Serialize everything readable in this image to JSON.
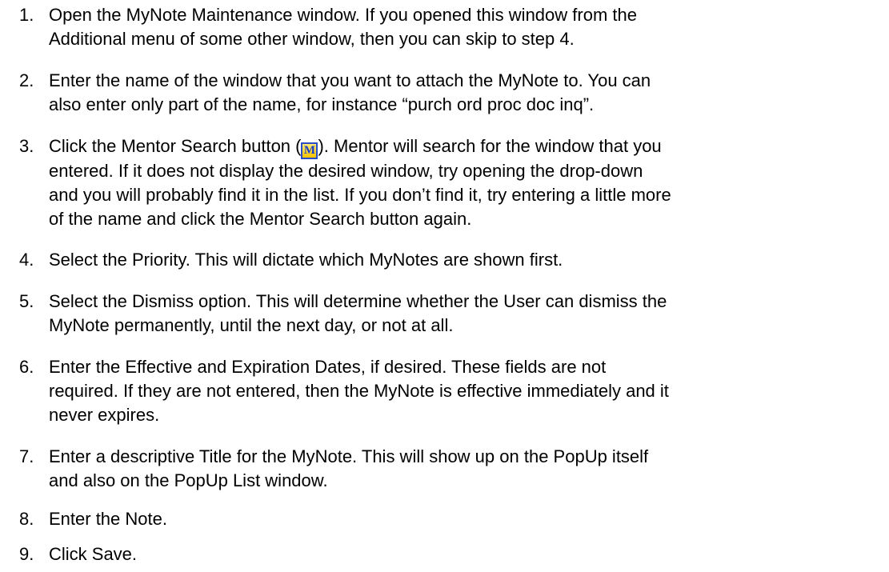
{
  "steps": [
    {
      "number": "1.",
      "lines": [
        "Open the MyNote Maintenance window.  If you opened this window from the",
        "Additional menu of some other window, then you can skip to step 4."
      ]
    },
    {
      "number": "2.",
      "lines": [
        "Enter the name of the window that you want to attach the MyNote to.  You can",
        "also enter only part of the name, for instance “purch ord proc doc inq”."
      ]
    },
    {
      "number": "3.",
      "line1_before_icon": "Click the Mentor Search button (",
      "icon_glyph": "M",
      "line1_after_icon": ").  Mentor will search for the window that you",
      "lines": [
        "entered.  If it does not display the desired window, try opening the drop-down",
        "and you will probably find it in the list.  If you don’t find it, try entering a little more",
        "of the name and click the Mentor Search button again."
      ]
    },
    {
      "number": "4.",
      "lines": [
        "Select the Priority. This will dictate which MyNotes are shown first."
      ]
    },
    {
      "number": "5.",
      "lines": [
        "Select the Dismiss option.  This will determine whether the User can dismiss the",
        "MyNote permanently, until the next day, or not at all."
      ]
    },
    {
      "number": "6.",
      "lines": [
        "Enter the Effective and Expiration Dates, if desired.  These fields are not",
        "required.  If they are not entered, then the MyNote is effective immediately and it",
        "never expires."
      ]
    },
    {
      "number": "7.",
      "lines": [
        "Enter a descriptive Title for the MyNote.  This will show up on the PopUp itself",
        "and also on the PopUp List window."
      ]
    },
    {
      "number": "8.",
      "lines": [
        "Enter the Note."
      ]
    },
    {
      "number": "9.",
      "lines": [
        "Click Save."
      ]
    }
  ]
}
